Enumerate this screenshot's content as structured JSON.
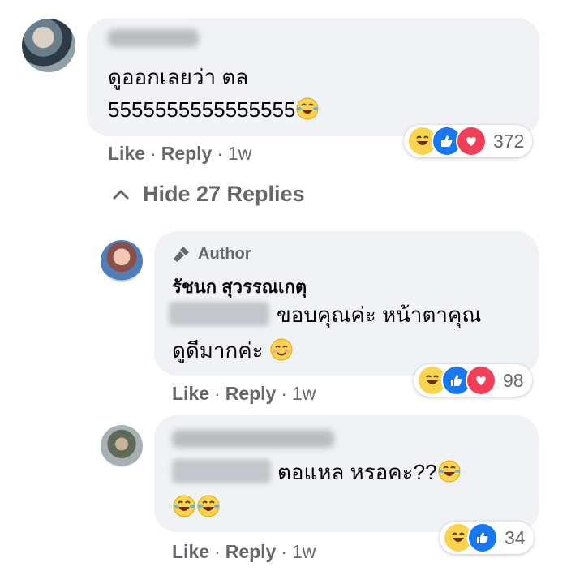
{
  "comment": {
    "text_line1": "ดูออกเลยว่า ตล",
    "text_line2": "5555555555555555",
    "reactions": [
      "haha",
      "like",
      "love"
    ],
    "reaction_count": "372",
    "actions": {
      "like": "Like",
      "reply": "Reply",
      "time": "1w"
    }
  },
  "replies_toggle": {
    "label": "Hide 27 Replies",
    "icon": "chevron-up-icon"
  },
  "reply1": {
    "badge": "Author",
    "author": "รัชนก สุวรรณเกตุ",
    "text_line1": "ขอบคุณค่ะ หน้าตาคุณ",
    "text_line2": "ดูดีมากค่ะ",
    "reactions": [
      "haha",
      "like",
      "love"
    ],
    "reaction_count": "98",
    "actions": {
      "like": "Like",
      "reply": "Reply",
      "time": "1w"
    }
  },
  "reply2": {
    "text_line1": "ตอแหล หรอคะ??",
    "reactions": [
      "haha",
      "like"
    ],
    "reaction_count": "34",
    "actions": {
      "like": "Like",
      "reply": "Reply",
      "time": "1w"
    }
  },
  "colors": {
    "bubble": "#f0f2f5",
    "meta_text": "#65676b",
    "like_blue": "#1877f2",
    "love_red": "#f33e58",
    "haha_yellow": "#fcd34d"
  }
}
